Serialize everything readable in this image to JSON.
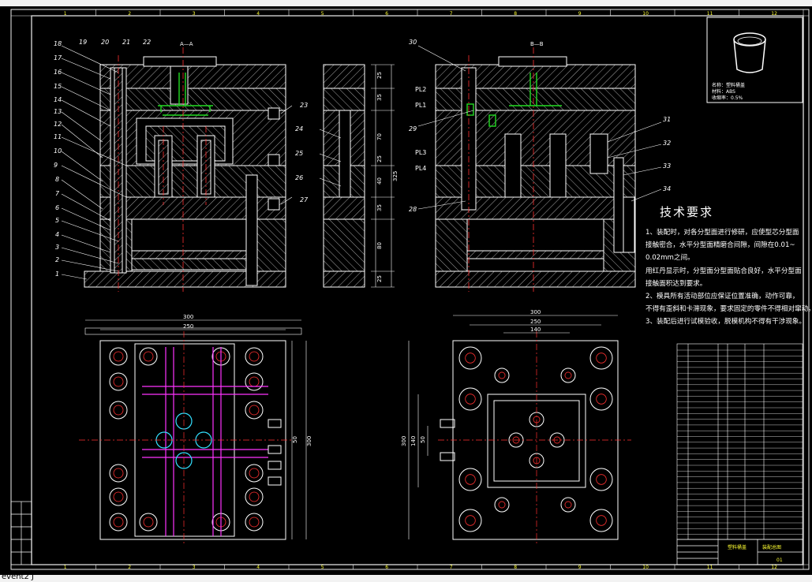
{
  "window": {
    "top_fragment": "",
    "command_fragment": "event2 J"
  },
  "colors": {
    "background": "#000000",
    "line": "#ffffff",
    "center": "#ff3030",
    "green": "#22dd22",
    "magenta": "#ff33ff",
    "cyan": "#33e0ff",
    "yellow": "#ffff33",
    "frame": "#f0f0f0"
  },
  "border_numbers": {
    "top": [
      "1",
      "2",
      "3",
      "4",
      "5",
      "6",
      "7",
      "8",
      "9",
      "10",
      "11",
      "12"
    ],
    "bottom": [
      "1",
      "2",
      "3",
      "4",
      "5",
      "6",
      "7",
      "8",
      "9",
      "10",
      "11",
      "12"
    ]
  },
  "section_labels": {
    "a": "A—A",
    "b": "B—B"
  },
  "part_numbers_left": [
    "18",
    "17",
    "16",
    "15",
    "14",
    "13",
    "12",
    "11",
    "10",
    "9",
    "8",
    "7",
    "6",
    "5",
    "4",
    "3",
    "2",
    "1"
  ],
  "part_numbers_top": [
    "19",
    "20",
    "21",
    "22"
  ],
  "part_numbers_right": [
    "23",
    "24",
    "25",
    "26",
    "27"
  ],
  "part_numbers_b": [
    "30",
    "29",
    "28",
    "31",
    "32",
    "33",
    "34"
  ],
  "parting_lines": [
    "PL2",
    "PL1",
    "PL3",
    "PL4"
  ],
  "dimensions": {
    "side_stack": [
      "25",
      "35",
      "70",
      "25",
      "40",
      "35",
      "80",
      "25",
      "325"
    ],
    "plan_a": {
      "overall": "300",
      "inner": "250",
      "right_small": "50",
      "right_total": "300"
    },
    "plan_b": {
      "overall": "300",
      "inner": "250",
      "small": "140",
      "left_total": "300",
      "left_mid": "140",
      "left_small": "50"
    }
  },
  "part_info": {
    "row1": "名称：塑料桶盖",
    "row2": "材料：ABS",
    "row3": "收缩率：0.5%"
  },
  "tech_requirements": {
    "title": "技术要求",
    "lines": [
      "1、装配时，对各分型面进行修研，应使型芯分型面",
      "接触密合，水平分型面精磨合间隙，间隙在0.01~",
      "0.02mm之间。",
      "用红丹显示时，分型面分型面贴合良好，水平分型面",
      "接触面积达到要求。",
      "2、模具所有活动部位应保证位置准确，动作可靠，",
      "不得有歪斜和卡滞现象，要求固定的零件不得相对窜动。",
      "3、装配后进行试模验收，脱模机构不得有干涉现象。"
    ]
  },
  "title_block": {
    "drawing_name": "装配总图",
    "sheet": "01",
    "project": "塑料桶盖"
  },
  "left_strip": [
    "",
    "",
    "",
    "",
    ""
  ]
}
